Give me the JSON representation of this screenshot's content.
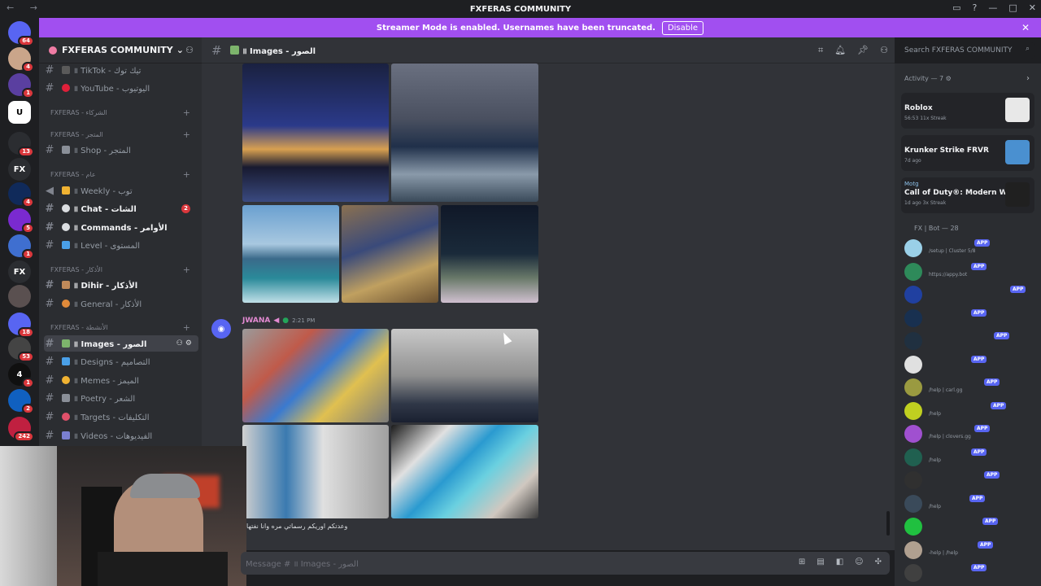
{
  "window": {
    "title": "FXFERAS COMMUNITY"
  },
  "banner": {
    "text": "Streamer Mode is enabled. Usernames have been truncated.",
    "button": "Disable"
  },
  "server": {
    "name": "FXFERAS COMMUNITY"
  },
  "servers": [
    {
      "label": "",
      "badge": "64",
      "color": "#5865f2"
    },
    {
      "label": "",
      "badge": "4",
      "color": "#caa58a"
    },
    {
      "label": "",
      "badge": "1",
      "color": "#5a3fa0"
    },
    {
      "label": "U",
      "badge": "",
      "color": "#ffffff"
    },
    {
      "label": "",
      "badge": "13",
      "color": "#2b2d31"
    },
    {
      "label": "FX",
      "badge": "",
      "color": "#2b2d31"
    },
    {
      "label": "",
      "badge": "4",
      "color": "#102a5a"
    },
    {
      "label": "",
      "badge": "5",
      "color": "#7a2ad0"
    },
    {
      "label": "",
      "badge": "1",
      "color": "#3f6fd0"
    },
    {
      "label": "FX",
      "badge": "",
      "color": "#2b2d31"
    },
    {
      "label": "",
      "badge": "",
      "color": "#5a5050"
    },
    {
      "label": "",
      "badge": "18",
      "color": "#5865f2"
    },
    {
      "label": "",
      "badge": "53",
      "color": "#444"
    },
    {
      "label": "4",
      "badge": "1",
      "color": "#101010"
    },
    {
      "label": "",
      "badge": "2",
      "color": "#1060c0"
    },
    {
      "label": "",
      "badge": "242",
      "color": "#c02040"
    }
  ],
  "channels": {
    "tiktok": "॥ TikTok - تيك توك",
    "youtube": "॥ YouTube - اليوتيوب",
    "cat_partners": "FXFERAS - الشركاء",
    "cat_store": "FXFERAS - المتجر",
    "shop": "॥ Shop - المتجر",
    "cat_general": "FXFERAS - عام",
    "weekly": "॥ Weekly - توب",
    "chat": "॥ Chat - الشات",
    "chat_badge": "2",
    "commands": "॥ Commands - الأوامر",
    "level": "॥ Level - المستوى",
    "cat_adhkar": "FXFERAS - الأذكار",
    "dihir": "॥ Dihir - الأذكار",
    "general": "॥ General - الأذكار",
    "cat_activities": "FXFERAS - الأنشطة",
    "images": "॥ Images - الصور",
    "designs": "॥ Designs - التصاميم",
    "memes": "॥ Memes - الميمز",
    "poetry": "॥ Poetry - الشعر",
    "targets": "॥ Targets - التكليفات",
    "videos": "॥ Videos - الفيديوهات"
  },
  "header": {
    "channel": "॥ Images - الصور"
  },
  "search": {
    "placeholder": "Search FXFERAS COMMUNITY"
  },
  "message": {
    "author": "JWANA",
    "time": "2:21 PM",
    "text": "وعدتكم اوريكم رسماتي مره وانا نفتها"
  },
  "composer": {
    "placeholder": "Message #  ॥ Images - الصور"
  },
  "members": {
    "activity_header": "Activity — 7",
    "activities": [
      {
        "name": "",
        "game": "Roblox",
        "meta": "56:53  11x Streak",
        "thumb": "#e8e8e8"
      },
      {
        "name": "",
        "game": "Krunker Strike FRVR",
        "meta": "7d ago",
        "thumb": "#4a90d0"
      },
      {
        "name": "Motg",
        "game": "Call of Duty®: Modern Warf...",
        "meta": "1d ago  3x Streak",
        "thumb": "#202020"
      }
    ],
    "bot_header": "FX | Bot — 28",
    "bots": [
      {
        "status": "/setup | Cluster 5/8",
        "color": "#9ad0e8"
      },
      {
        "status": "https://appy.bot",
        "color": "#2e8a5a"
      },
      {
        "status": "",
        "color": "#2040a0"
      },
      {
        "status": "",
        "color": "#183050"
      },
      {
        "status": "",
        "color": "#203040"
      },
      {
        "status": "",
        "color": "#e0e0e0"
      },
      {
        "status": "/help | carl.gg",
        "color": "#9a9a40"
      },
      {
        "status": "/help",
        "color": "#c0d020"
      },
      {
        "status": "/help | clovers.gg",
        "color": "#a050d0"
      },
      {
        "status": "/help",
        "color": "#206050"
      },
      {
        "status": "",
        "color": "#303030"
      },
      {
        "status": "/help",
        "color": "#3a4a5a"
      },
      {
        "status": "",
        "color": "#20c040"
      },
      {
        "status": "-help | /help",
        "color": "#b0a090"
      },
      {
        "status": "",
        "color": "#404040"
      }
    ],
    "app_label": "APP"
  }
}
